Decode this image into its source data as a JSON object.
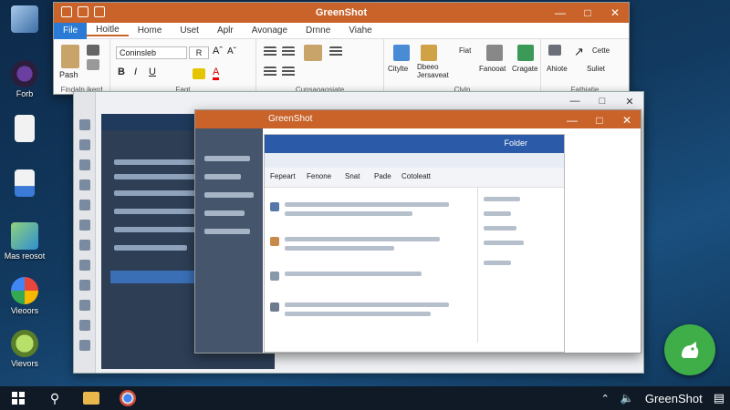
{
  "desktop": {
    "icons": [
      {
        "label": ""
      },
      {
        "label": "Forb"
      },
      {
        "label": ""
      },
      {
        "label": ""
      },
      {
        "label": "Mas reosot"
      },
      {
        "label": "Vieoors"
      },
      {
        "label": "Vievors"
      }
    ]
  },
  "main_window": {
    "title": "GreenShot",
    "tabs": [
      "File",
      "Hoitle",
      "Home",
      "Uset",
      "Aplr",
      "Avonage",
      "Drnne",
      "Viahe"
    ],
    "font_name": "Coninsleb",
    "font_size": "R",
    "groups": [
      {
        "label": "Findaln ikerd"
      },
      {
        "label": "Fagt"
      },
      {
        "label": "Cunsaoaosiate"
      },
      {
        "label": "Clyln"
      },
      {
        "label": "Fathiatie"
      }
    ],
    "paste_label": "Pash",
    "sample_buttons": [
      {
        "label": "Citylte"
      },
      {
        "label": "Dbeeo Jersaveat"
      },
      {
        "label": "Fiat"
      },
      {
        "label": "Fanooat"
      },
      {
        "label": "Cragate"
      },
      {
        "label": "Cette"
      },
      {
        "label": "Ahiote"
      },
      {
        "label": "Suliet"
      }
    ]
  },
  "third_window": {
    "title": "GreenShot",
    "inner_title": "Folder",
    "inner_items": [
      {
        "label": "Fepeart"
      },
      {
        "label": "Fenone"
      },
      {
        "label": "Snat"
      },
      {
        "label": "Pade"
      },
      {
        "label": "Cotoleatt"
      }
    ]
  },
  "tray": {
    "app_name": "GreenShot"
  },
  "colors": {
    "accent_orange": "#c9632a",
    "file_blue": "#2b7ad6",
    "fab_green": "#3fae49",
    "taskbar": "#0f1a26"
  }
}
